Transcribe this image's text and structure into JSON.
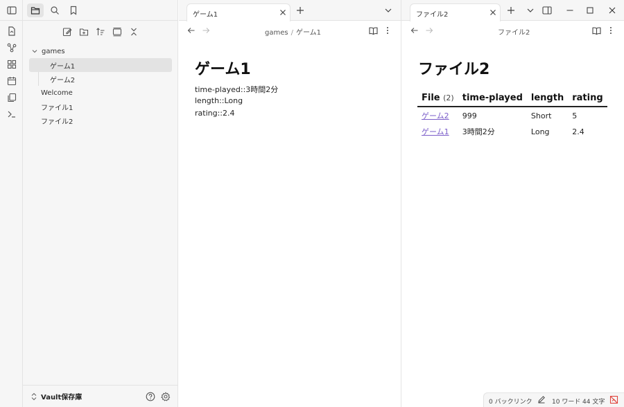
{
  "colors": {
    "accent": "#7a5cc9",
    "chrome": "#f6f6f6",
    "border": "#e3e3e3",
    "status_icon": "#e0443d"
  },
  "ribbon": {
    "icons": [
      "sidebar-toggle-icon",
      "open-quick-switcher-icon",
      "graph-view-icon",
      "canvas-icon",
      "daily-note-icon",
      "templates-icon",
      "command-palette-icon"
    ]
  },
  "sidebar": {
    "tabs": [
      "files-icon",
      "search-icon",
      "bookmark-icon"
    ],
    "actions": [
      "new-note-icon",
      "new-folder-icon",
      "sort-icon",
      "collapse-view-icon",
      "close-all-icon"
    ],
    "tree": {
      "folder": "games",
      "items": [
        {
          "label": "ゲーム1",
          "active": true
        },
        {
          "label": "ゲーム2",
          "active": false
        }
      ],
      "root_files": [
        "Welcome",
        "ファイル1",
        "ファイル2"
      ]
    },
    "vault": {
      "name": "Vault保存庫"
    }
  },
  "left_pane": {
    "tab_title": "ゲーム1",
    "breadcrumb": {
      "folder": "games",
      "separator": "/",
      "file": "ゲーム1"
    },
    "note": {
      "title": "ゲーム1",
      "lines": [
        "time-played::3時間2分",
        "length::Long",
        "rating::2.4"
      ]
    }
  },
  "right_pane": {
    "tab_title": "ファイル2",
    "breadcrumb": "ファイル2",
    "note": {
      "title": "ファイル2",
      "table": {
        "headers": [
          "File",
          "time-played",
          "length",
          "rating"
        ],
        "file_count": "(2)",
        "rows": [
          {
            "file": "ゲーム2",
            "time_played": "999",
            "length": "Short",
            "rating": "5"
          },
          {
            "file": "ゲーム1",
            "time_played": "3時間2分",
            "length": "Long",
            "rating": "2.4"
          }
        ]
      }
    }
  },
  "status_bar": {
    "backlinks": "0 バックリンク",
    "words": "10 ワード",
    "chars": "44 文字"
  }
}
